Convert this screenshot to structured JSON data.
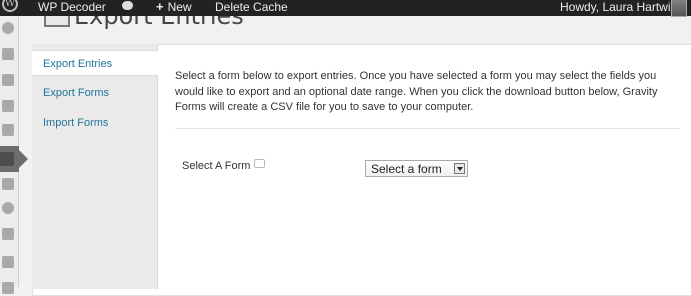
{
  "admin_bar": {
    "site_name": "WP Decoder",
    "new_label": "New",
    "delete_cache_label": "Delete Cache",
    "greeting": "Howdy, Laura Hartwig"
  },
  "page": {
    "title": "Export Entries"
  },
  "tabs": [
    {
      "label": "Export Entries",
      "active": true
    },
    {
      "label": "Export Forms",
      "active": false
    },
    {
      "label": "Import Forms",
      "active": false
    }
  ],
  "main": {
    "description": "Select a form below to export entries. Once you have selected a form you may select the fields you would like to export and an optional date range. When you click the download button below, Gravity Forms will create a CSV file for you to save to your computer.",
    "select_label": "Select A Form",
    "select_value": "Select a form"
  },
  "icons": {
    "wordpress": "wordpress-logo-icon",
    "comments": "comment-bubble-icon",
    "new": "plus-icon",
    "help": "help-tooltip-icon",
    "dropdown": "chevron-down-icon"
  },
  "colors": {
    "link": "#21759b",
    "admin_bar": "#222222",
    "current_menu": "#6d6d6d"
  }
}
